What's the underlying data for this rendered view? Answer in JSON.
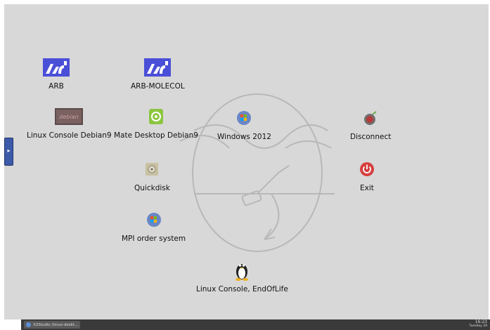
{
  "desktop": {
    "icons": [
      {
        "label": "ARB",
        "icon": "arb-logo-icon"
      },
      {
        "label": "ARB-MOLECOL",
        "icon": "arb-logo-icon"
      },
      {
        "label": "Linux Console Debian9",
        "icon": "debian-icon"
      },
      {
        "label": "Mate Desktop Debian9",
        "icon": "mate-icon"
      },
      {
        "label": "Windows 2012",
        "icon": "windows-icon"
      },
      {
        "label": "Disconnect",
        "icon": "disconnect-icon"
      },
      {
        "label": "Quickdisk",
        "icon": "disk-icon"
      },
      {
        "label": "Exit",
        "icon": "power-icon"
      },
      {
        "label": "MPI order system",
        "icon": "windows-icon"
      },
      {
        "label": "Linux Console, EndOfLife",
        "icon": "tux-icon"
      }
    ]
  },
  "taskbar": {
    "task_label": "X2Studio (linux-deskt...",
    "clock_time": "16:23",
    "clock_date": "Tuesday 29 "
  },
  "colors": {
    "desktop_bg": "#d8d8d8",
    "arb_blue": "#4a4fd8",
    "taskbar_bg": "#3a3a3a",
    "side_tab": "#3c5aa8"
  }
}
